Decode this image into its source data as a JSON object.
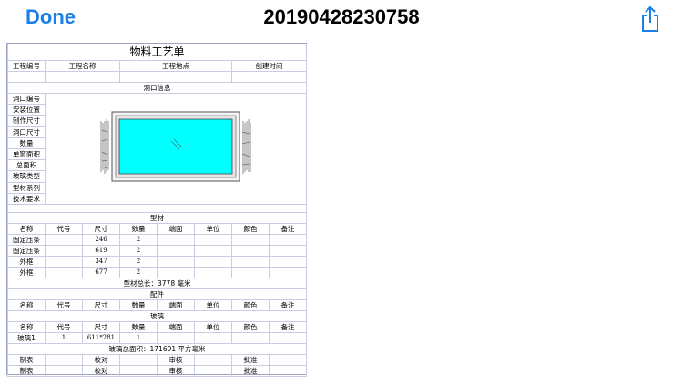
{
  "nav": {
    "done_label": "Done",
    "title": "20190428230758"
  },
  "doc": {
    "title": "物料工艺单",
    "project_headers": [
      "工程编号",
      "工程名称",
      "工程地点",
      "创建时间"
    ],
    "opening_section": "洞口信息",
    "opening_fields": [
      "洞口编号",
      "安装位置",
      "制作尺寸",
      "洞口尺寸",
      "数量",
      "单窗面积",
      "总面积",
      "玻璃类型",
      "型材系列",
      "技术要求"
    ],
    "profile_section": "型材",
    "columns": [
      "名称",
      "代号",
      "尺寸",
      "数量",
      "端面",
      "单位",
      "颜色",
      "备注"
    ],
    "profile_rows": [
      {
        "name": "固定压条",
        "size": "246",
        "qty": "2"
      },
      {
        "name": "固定压条",
        "size": "619",
        "qty": "2"
      },
      {
        "name": "外框",
        "size": "347",
        "qty": "2"
      },
      {
        "name": "外框",
        "size": "677",
        "qty": "2"
      }
    ],
    "profile_total": "型材总长：3778 毫米",
    "accessory_section": "配件",
    "glass_section": "玻璃",
    "glass_rows": [
      {
        "name": "玻璃1",
        "code": "1",
        "size": "611*281",
        "qty": "1"
      }
    ],
    "glass_total": "玻璃总面积：171691 平方毫米",
    "footer_labels": [
      "制表",
      "校对",
      "审核",
      "批准"
    ]
  },
  "colors": {
    "accent": "#1a7fe6",
    "glass": "#00ffff",
    "grid": "#c8cde0"
  }
}
